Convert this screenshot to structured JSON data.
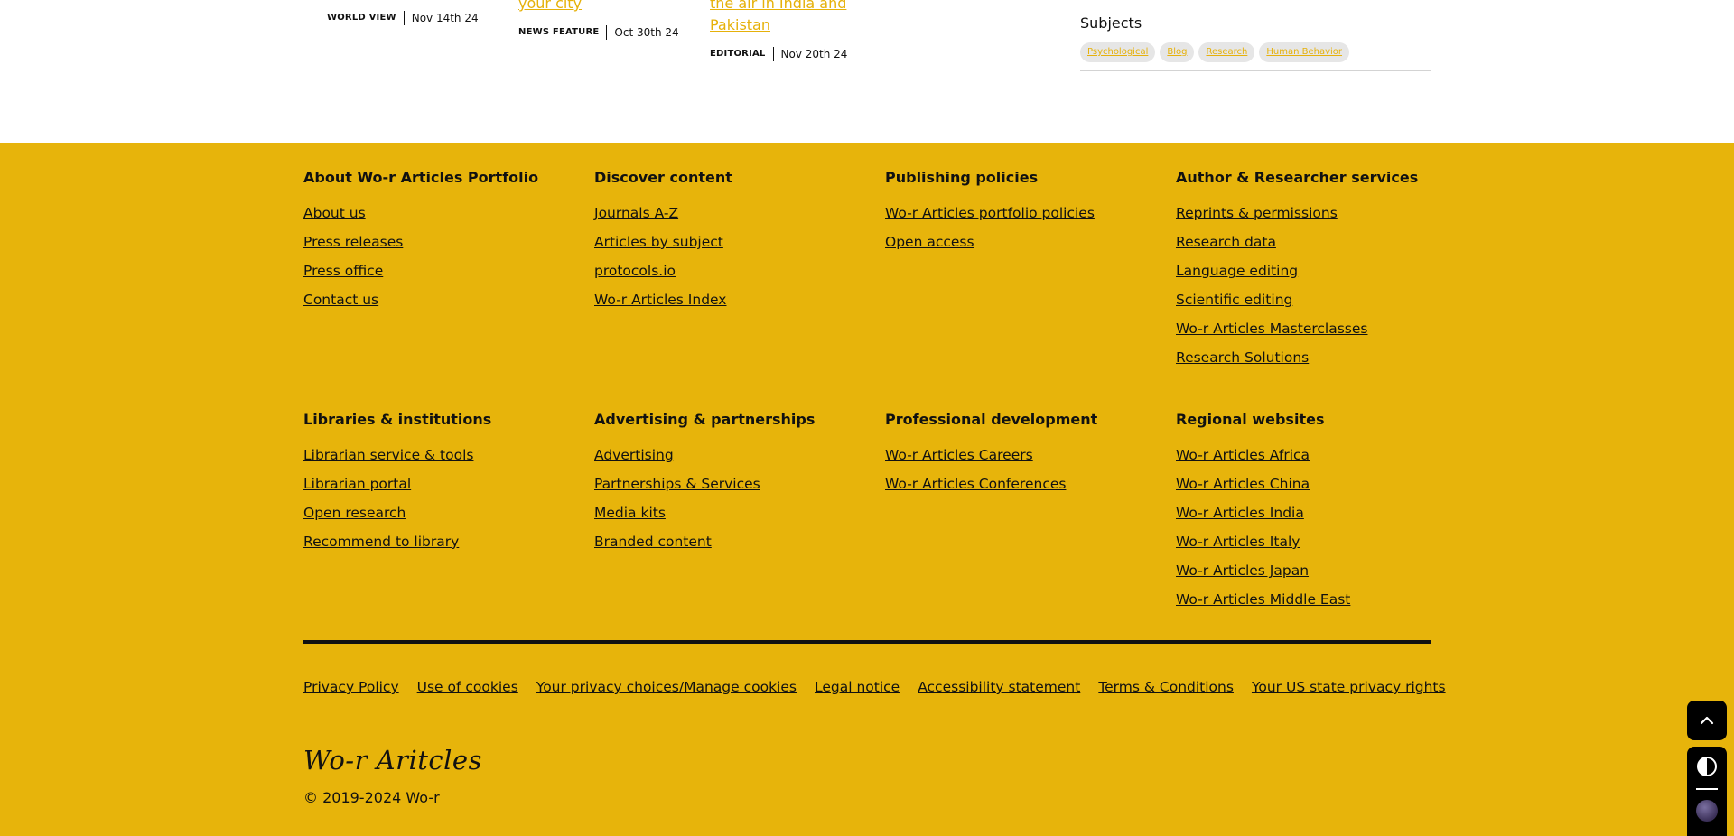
{
  "articles": [
    {
      "title_tail": "",
      "type": "WORLD VIEW",
      "date": "Nov 14th 24"
    },
    {
      "title_tail": "your city",
      "type": "NEWS FEATURE",
      "date": "Oct 30th 24"
    },
    {
      "title_tail_line1": "the air in India and",
      "title_tail_line2": "Pakistan",
      "type": "EDITORIAL",
      "date": "Nov 20th 24"
    }
  ],
  "subjects": {
    "heading": "Subjects",
    "tags": [
      "Psychological",
      "Blog",
      "Research",
      "Human Behavior"
    ]
  },
  "footer": {
    "columns": [
      {
        "heading": "About Wo-r Articles Portfolio",
        "links": [
          "About us",
          "Press releases",
          "Press office",
          "Contact us"
        ]
      },
      {
        "heading": "Discover content",
        "links": [
          "Journals A-Z",
          "Articles by subject",
          "protocols.io",
          "Wo-r Articles Index"
        ]
      },
      {
        "heading": "Publishing policies",
        "links": [
          "Wo-r Articles portfolio policies",
          "Open access"
        ]
      },
      {
        "heading": "Author & Researcher services",
        "links": [
          "Reprints & permissions",
          "Research data",
          "Language editing",
          "Scientific editing",
          "Wo-r Articles Masterclasses",
          "Research Solutions"
        ]
      },
      {
        "heading": "Libraries & institutions",
        "links": [
          "Librarian service & tools",
          "Librarian portal",
          "Open research",
          "Recommend to library"
        ]
      },
      {
        "heading": "Advertising & partnerships",
        "links": [
          "Advertising",
          "Partnerships & Services",
          "Media kits",
          "Branded content"
        ]
      },
      {
        "heading": "Professional development",
        "links": [
          "Wo-r Articles Careers",
          "Wo-r Articles Conferences"
        ]
      },
      {
        "heading": "Regional websites",
        "links": [
          "Wo-r Articles Africa",
          "Wo-r Articles China",
          "Wo-r Articles India",
          "Wo-r Articles Italy",
          "Wo-r Articles Japan",
          "Wo-r Articles Middle East"
        ]
      }
    ],
    "legal_links": [
      "Privacy Policy",
      "Use of cookies",
      "Your privacy choices/Manage cookies",
      "Legal notice",
      "Accessibility statement",
      "Terms & Conditions",
      "Your US state privacy rights"
    ],
    "logo": "Wo-r Aritcles",
    "copyright": "© 2019-2024 Wo-r"
  },
  "floating": {
    "back_to_top_icon": "chevron-up-icon",
    "theme_icon": "contrast-icon"
  },
  "colors": {
    "footer_bg": "#e7b40b",
    "accent_link": "#e6b10a"
  }
}
